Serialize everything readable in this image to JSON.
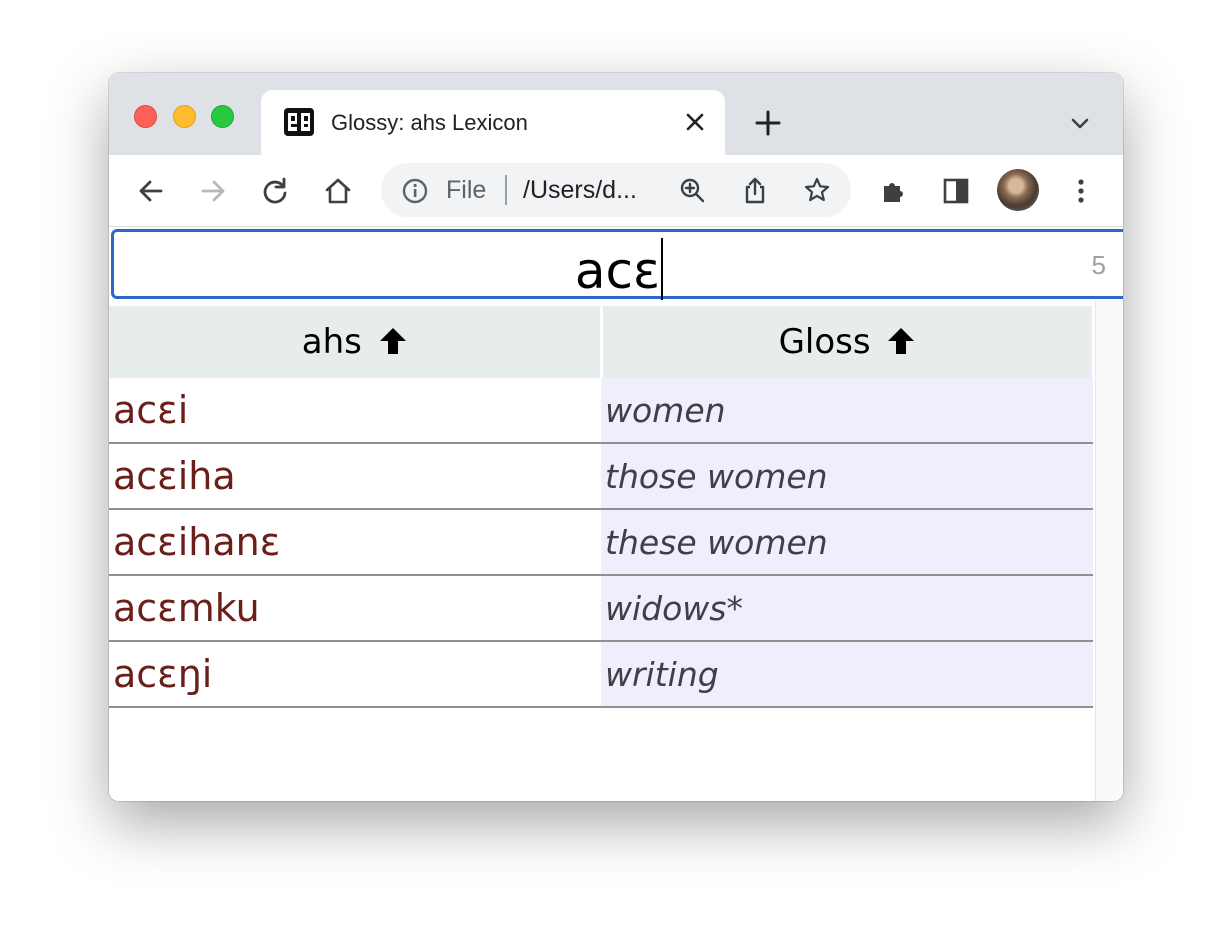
{
  "browser": {
    "tab_title": "Glossy: ahs Lexicon",
    "omnibox_scheme": "File",
    "omnibox_url": "/Users/d..."
  },
  "search": {
    "value": "acɛ",
    "result_count": "5"
  },
  "table": {
    "columns": [
      {
        "label": "ahs",
        "sort": "ascending"
      },
      {
        "label": "Gloss",
        "sort": "ascending"
      }
    ],
    "rows": [
      {
        "word": "acɛi",
        "gloss": "women"
      },
      {
        "word": "acɛiha",
        "gloss": "those women"
      },
      {
        "word": "acɛihanɛ",
        "gloss": "these women"
      },
      {
        "word": "acɛmku",
        "gloss": "widows*"
      },
      {
        "word": "acɛŋi",
        "gloss": "writing"
      }
    ]
  },
  "colors": {
    "search_border": "#2f66c9",
    "word_text": "#6b1f1a",
    "gloss_bg": "#eeeefd",
    "header_bg": "#e7eced"
  }
}
